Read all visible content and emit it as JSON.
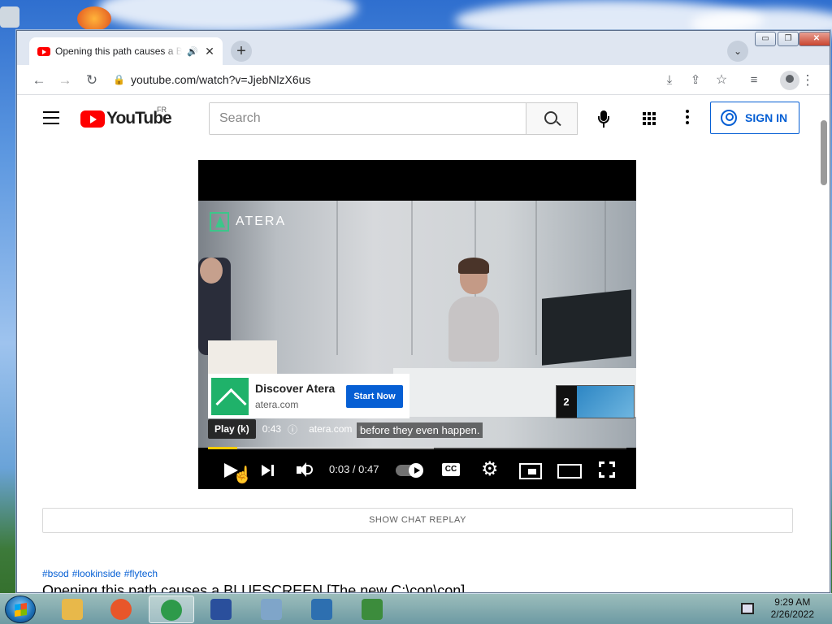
{
  "browser": {
    "tab_title": "Opening this path causes a BLUESCREEN [The new C:\\con\\con]",
    "tab_close": "✕",
    "new_tab": "+",
    "tab_search": "⌄",
    "url": "youtube.com/watch?v=JjebNlzX6us",
    "window_controls": {
      "minimize": "▭",
      "maximize": "❐",
      "close": "✕"
    }
  },
  "youtube": {
    "logo_text": "YouTube",
    "country_code": "FR",
    "search_placeholder": "Search",
    "sign_in_label": "SIGN IN"
  },
  "player": {
    "brand_text": "ATERA",
    "ad_card": {
      "title": "Discover Atera",
      "domain": "atera.com",
      "cta_label": "Start Now"
    },
    "skip_count": "2",
    "tooltip": "Play (k)",
    "ad_time": "0:43",
    "ad_info_icon": "ⓘ",
    "ad_link": "atera.com",
    "ad_link_icon": "⧉",
    "subtitle": "before they even happen.",
    "time_display": "0:03 / 0:47",
    "progress_played_fraction": 0.07,
    "progress_buffered_fraction": 0.54
  },
  "page": {
    "chat_replay_label": "SHOW CHAT REPLAY",
    "hashtags": [
      "#bsod",
      "#lookinside",
      "#flytech"
    ],
    "video_title": "Opening this path causes a BLUESCREEN [The new C:\\con\\con]"
  },
  "taskbar": {
    "time": "9:29 AM",
    "date": "2/26/2022",
    "apps": [
      {
        "name": "explorer-icon",
        "color": "#e8b84a"
      },
      {
        "name": "firefox-icon",
        "color": "#e8562a"
      },
      {
        "name": "chrome-icon",
        "color": "#2e9a4a"
      },
      {
        "name": "network-admin-icon",
        "color": "#2a4f9c"
      },
      {
        "name": "monitor-icon",
        "color": "#7fa5c9"
      },
      {
        "name": "virtualbox-icon",
        "color": "#2d6fb0"
      },
      {
        "name": "task-manager-icon",
        "color": "#3c8c3c"
      }
    ]
  }
}
